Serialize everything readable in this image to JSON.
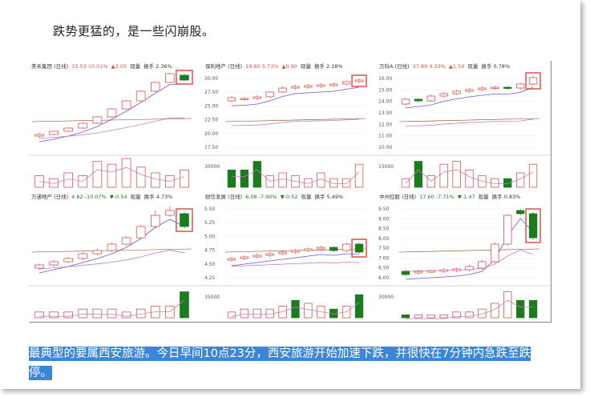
{
  "intro_text": "跌势更猛的，是一些闪崩股。",
  "caption_text": "最典型的要属西安旅游。今日早间10点23分，西安旅游开始加速下跌，并很快在7分钟内急跌至跌停。",
  "colors": {
    "up": "#d9534f",
    "down": "#1e7a1e",
    "ma1": "#6a5acd",
    "ma2": "#c080c0",
    "ma3": "#8b4513",
    "highlight": "#3d86d6"
  },
  "panels": [
    {
      "name": "美禾集团",
      "header": [
        "美禾集团 (日线)",
        "33.53 10.01%",
        "▲3.05",
        "现量",
        "换手 2.36%"
      ],
      "price_ticks": [],
      "vol_tick": "",
      "candles": [
        [
          0.8,
          0.78,
          0.82,
          0.76
        ],
        [
          0.78,
          0.74,
          0.79,
          0.73
        ],
        [
          0.74,
          0.7,
          0.75,
          0.69
        ],
        [
          0.7,
          0.64,
          0.71,
          0.63
        ],
        [
          0.64,
          0.56,
          0.65,
          0.55
        ],
        [
          0.56,
          0.46,
          0.57,
          0.45
        ],
        [
          0.46,
          0.36,
          0.47,
          0.35
        ],
        [
          0.36,
          0.24,
          0.37,
          0.23
        ],
        [
          0.24,
          0.13,
          0.25,
          0.12
        ],
        [
          0.13,
          0.02,
          0.14,
          0.01
        ],
        [
          0.04,
          0.1,
          0.02,
          0.11
        ]
      ],
      "volumes": [
        0.4,
        0.3,
        0.5,
        0.4,
        0.9,
        0.8,
        1.0,
        0.7,
        0.5,
        0.4,
        0.6
      ],
      "vol_down": [
        false,
        false,
        false,
        false,
        false,
        false,
        false,
        false,
        false,
        false,
        false
      ]
    },
    {
      "name": "保利地产",
      "header": [
        "保利地产 (日线)",
        "19.60 5.73%",
        "▲0.90",
        "现量",
        "换手 2.18%"
      ],
      "price_ticks": [
        "30.00",
        "27.50",
        "25.00",
        "22.50",
        "20.00",
        "17.50"
      ],
      "vol_tick": "30000",
      "candles": [
        [
          0.36,
          0.32,
          0.38,
          0.3
        ],
        [
          0.34,
          0.33,
          0.36,
          0.31
        ],
        [
          0.33,
          0.31,
          0.35,
          0.29
        ],
        [
          0.31,
          0.25,
          0.32,
          0.24
        ],
        [
          0.25,
          0.2,
          0.26,
          0.18
        ],
        [
          0.2,
          0.18,
          0.22,
          0.16
        ],
        [
          0.19,
          0.17,
          0.21,
          0.15
        ],
        [
          0.18,
          0.16,
          0.2,
          0.14
        ],
        [
          0.17,
          0.15,
          0.19,
          0.13
        ],
        [
          0.15,
          0.12,
          0.17,
          0.11
        ],
        [
          0.12,
          0.1,
          0.14,
          0.08
        ]
      ],
      "volumes": [
        0.6,
        0.6,
        0.9,
        0.4,
        0.5,
        0.4,
        0.3,
        0.5,
        0.3,
        0.3,
        0.8
      ],
      "vol_down": [
        true,
        true,
        true,
        false,
        false,
        false,
        false,
        false,
        false,
        false,
        false
      ]
    },
    {
      "name": "万科A",
      "header": [
        "万科A (日线)",
        "37.89 4.33%",
        "▲1.54",
        "现量",
        "换手 0.78%"
      ],
      "price_ticks": [
        "16.00",
        "15.00",
        "14.00",
        "13.00",
        "12.00",
        "11.00",
        "10.00"
      ],
      "vol_tick": "15000",
      "candles": [
        [
          0.4,
          0.34,
          0.42,
          0.32
        ],
        [
          0.34,
          0.36,
          0.33,
          0.38
        ],
        [
          0.36,
          0.3,
          0.37,
          0.28
        ],
        [
          0.3,
          0.27,
          0.32,
          0.25
        ],
        [
          0.27,
          0.24,
          0.29,
          0.22
        ],
        [
          0.24,
          0.22,
          0.26,
          0.2
        ],
        [
          0.22,
          0.2,
          0.24,
          0.18
        ],
        [
          0.2,
          0.19,
          0.22,
          0.17
        ],
        [
          0.19,
          0.2,
          0.18,
          0.22
        ],
        [
          0.2,
          0.15,
          0.22,
          0.13
        ],
        [
          0.15,
          0.07,
          0.17,
          0.05
        ]
      ],
      "volumes": [
        0.3,
        0.9,
        0.4,
        0.8,
        0.9,
        0.6,
        0.4,
        0.3,
        0.3,
        0.5,
        0.8
      ],
      "vol_down": [
        false,
        true,
        false,
        false,
        false,
        false,
        false,
        false,
        true,
        false,
        false
      ]
    },
    {
      "name": "万通地产",
      "header": [
        "万通地产 (日线)",
        "4.82 -10.07%",
        "▼-0.54",
        "现量",
        "换手 4.73%"
      ],
      "price_ticks": [],
      "vol_tick": "",
      "candles": [
        [
          0.82,
          0.78,
          0.84,
          0.76
        ],
        [
          0.78,
          0.74,
          0.8,
          0.72
        ],
        [
          0.74,
          0.7,
          0.76,
          0.68
        ],
        [
          0.7,
          0.64,
          0.72,
          0.62
        ],
        [
          0.64,
          0.6,
          0.66,
          0.58
        ],
        [
          0.6,
          0.52,
          0.62,
          0.5
        ],
        [
          0.52,
          0.44,
          0.54,
          0.42
        ],
        [
          0.44,
          0.3,
          0.46,
          0.28
        ],
        [
          0.3,
          0.16,
          0.32,
          0.1
        ],
        [
          0.16,
          0.1,
          0.18,
          0.05
        ],
        [
          0.14,
          0.3,
          0.12,
          0.32
        ]
      ],
      "volumes": [
        0.2,
        0.2,
        0.2,
        0.3,
        0.3,
        0.3,
        0.2,
        0.3,
        0.4,
        0.4,
        0.9
      ],
      "vol_down": [
        false,
        false,
        false,
        false,
        false,
        false,
        false,
        false,
        false,
        false,
        true
      ]
    },
    {
      "name": "财信发展",
      "header": [
        "财信发展 (日线)",
        "6.08 -7.90%",
        "▼-0.52",
        "现量",
        "换手 5.49%"
      ],
      "price_ticks": [
        "5.50",
        "5.25",
        "5.00",
        "4.75",
        "4.50",
        "4.25"
      ],
      "vol_tick": "35000",
      "candles": [
        [
          0.72,
          0.7,
          0.74,
          0.68
        ],
        [
          0.7,
          0.68,
          0.72,
          0.66
        ],
        [
          0.68,
          0.66,
          0.7,
          0.64
        ],
        [
          0.66,
          0.64,
          0.68,
          0.62
        ],
        [
          0.64,
          0.62,
          0.66,
          0.6
        ],
        [
          0.62,
          0.6,
          0.64,
          0.58
        ],
        [
          0.6,
          0.58,
          0.62,
          0.56
        ],
        [
          0.58,
          0.56,
          0.6,
          0.54
        ],
        [
          0.56,
          0.6,
          0.55,
          0.62
        ],
        [
          0.6,
          0.52,
          0.62,
          0.5
        ],
        [
          0.52,
          0.62,
          0.5,
          0.64
        ]
      ],
      "volumes": [
        0.2,
        0.3,
        0.3,
        0.3,
        0.4,
        0.6,
        0.5,
        0.4,
        0.3,
        0.4,
        0.8
      ],
      "vol_down": [
        false,
        false,
        false,
        false,
        false,
        true,
        false,
        false,
        true,
        false,
        true
      ]
    },
    {
      "name": "中州控股",
      "header": [
        "中州控股 (日线)",
        "17.60 -7.71%",
        "▼-1.47",
        "现量",
        "换手 0.83%"
      ],
      "price_ticks": [
        "9.50",
        "9.00",
        "8.50",
        "8.00",
        "7.50",
        "7.00",
        "6.50",
        "6.00"
      ],
      "vol_tick": "30000",
      "candles": [
        [
          0.86,
          0.9,
          0.84,
          0.92
        ],
        [
          0.88,
          0.86,
          0.9,
          0.84
        ],
        [
          0.87,
          0.85,
          0.88,
          0.84
        ],
        [
          0.86,
          0.84,
          0.88,
          0.82
        ],
        [
          0.85,
          0.83,
          0.87,
          0.81
        ],
        [
          0.84,
          0.8,
          0.86,
          0.78
        ],
        [
          0.82,
          0.74,
          0.84,
          0.72
        ],
        [
          0.74,
          0.52,
          0.76,
          0.5
        ],
        [
          0.52,
          0.16,
          0.54,
          0.14
        ],
        [
          0.1,
          0.14,
          0.08,
          0.16
        ],
        [
          0.14,
          0.44,
          0.12,
          0.46
        ]
      ],
      "volumes": [
        0.1,
        0.1,
        0.1,
        0.1,
        0.2,
        0.2,
        0.3,
        0.5,
        0.9,
        0.6,
        0.6
      ],
      "vol_down": [
        true,
        false,
        false,
        false,
        false,
        false,
        false,
        false,
        false,
        true,
        true
      ]
    }
  ]
}
